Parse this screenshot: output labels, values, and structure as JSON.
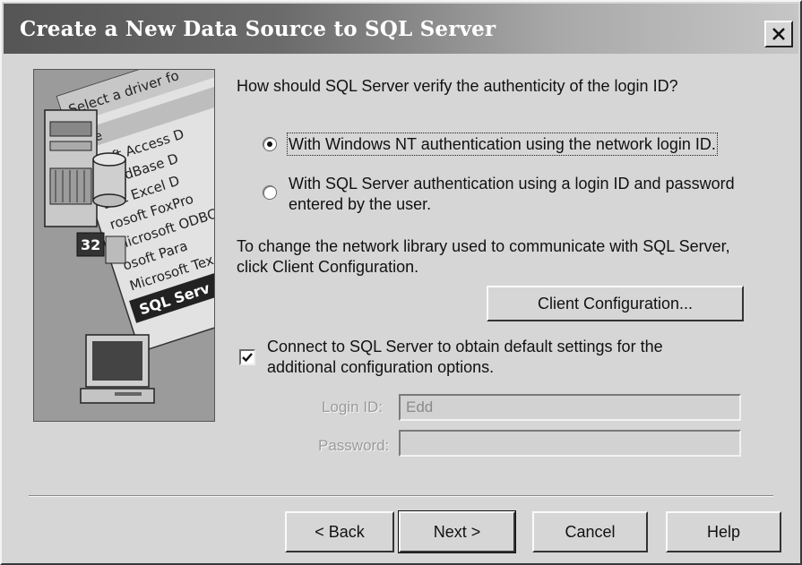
{
  "window": {
    "title": "Create a New Data Source to SQL Server"
  },
  "illustration": {
    "header_text": "Select a driver fo",
    "column_label": "me",
    "driver_list": [
      "osoft Access D",
      "soft dBase D",
      "soft Excel D",
      "rosoft FoxPro",
      "Microsoft ODBC",
      "osoft Para",
      "Microsoft Tex",
      "SQL Serv"
    ],
    "badge": "32"
  },
  "auth": {
    "question": "How should SQL Server verify the authenticity of the login ID?",
    "option_nt": "With Windows NT authentication using the network login ID.",
    "option_sql_line1": "With SQL Server authentication using a login ID and password",
    "option_sql_line2": "entered by the user.",
    "selected": "nt"
  },
  "network": {
    "line1": "To change the network library used to communicate with SQL Server,",
    "line2": "click Client Configuration.",
    "client_config_label": "Client Configuration..."
  },
  "connect": {
    "line1": "Connect to SQL Server to obtain default settings for the",
    "line2": "additional configuration options.",
    "checked": true
  },
  "login": {
    "login_id_label": "Login ID:",
    "login_id_value": "Edd",
    "password_label": "Password:",
    "password_value": ""
  },
  "buttons": {
    "back": "< Back",
    "next": "Next >",
    "cancel": "Cancel",
    "help": "Help"
  }
}
